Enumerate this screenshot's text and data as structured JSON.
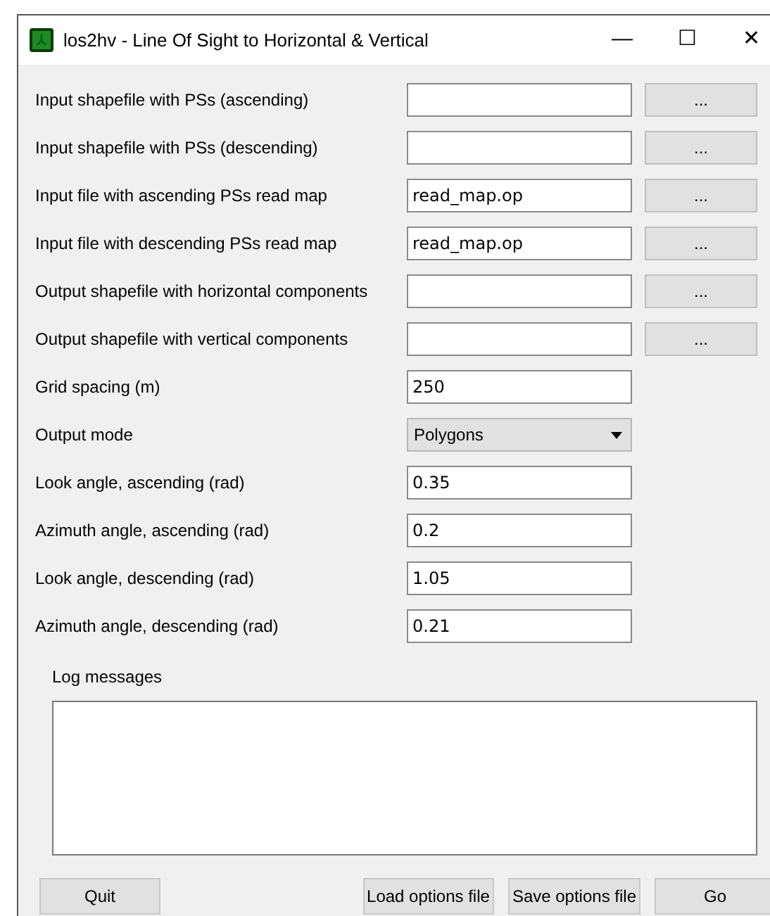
{
  "window": {
    "title": "los2hv - Line Of Sight to Horizontal & Vertical",
    "controls": [
      "—",
      "☐",
      "✕"
    ]
  },
  "rows": [
    {
      "kind": "file",
      "label": "Input shapefile with PSs (ascending)",
      "value": "",
      "button": "..."
    },
    {
      "kind": "file",
      "label": "Input shapefile with PSs (descending)",
      "value": "",
      "button": "..."
    },
    {
      "kind": "file",
      "label": "Input file with ascending PSs read map",
      "value": "read_map.op",
      "button": "..."
    },
    {
      "kind": "file",
      "label": "Input file with descending PSs read map",
      "value": "read_map.op",
      "button": "..."
    },
    {
      "kind": "file",
      "label": "Output shapefile with horizontal components",
      "value": "",
      "button": "..."
    },
    {
      "kind": "file",
      "label": "Output shapefile with vertical components",
      "value": "",
      "button": "..."
    },
    {
      "kind": "text",
      "label": "Grid spacing (m)",
      "value": "250"
    },
    {
      "kind": "select",
      "label": "Output mode",
      "value": "Polygons"
    },
    {
      "kind": "text",
      "label": "Look angle, ascending (rad)",
      "value": "0.35"
    },
    {
      "kind": "text",
      "label": "Azimuth angle, ascending (rad)",
      "value": "0.2"
    },
    {
      "kind": "text",
      "label": "Look angle, descending (rad)",
      "value": "1.05"
    },
    {
      "kind": "text",
      "label": "Azimuth angle, descending (rad)",
      "value": "0.21"
    }
  ],
  "log": {
    "label": "Log messages"
  },
  "buttons": [
    {
      "label": "Quit",
      "kind": "left"
    },
    {
      "label": "Load options file",
      "kind": "right"
    },
    {
      "label": "Save options file",
      "kind": "right"
    },
    {
      "label": "Go",
      "kind": "right"
    }
  ]
}
